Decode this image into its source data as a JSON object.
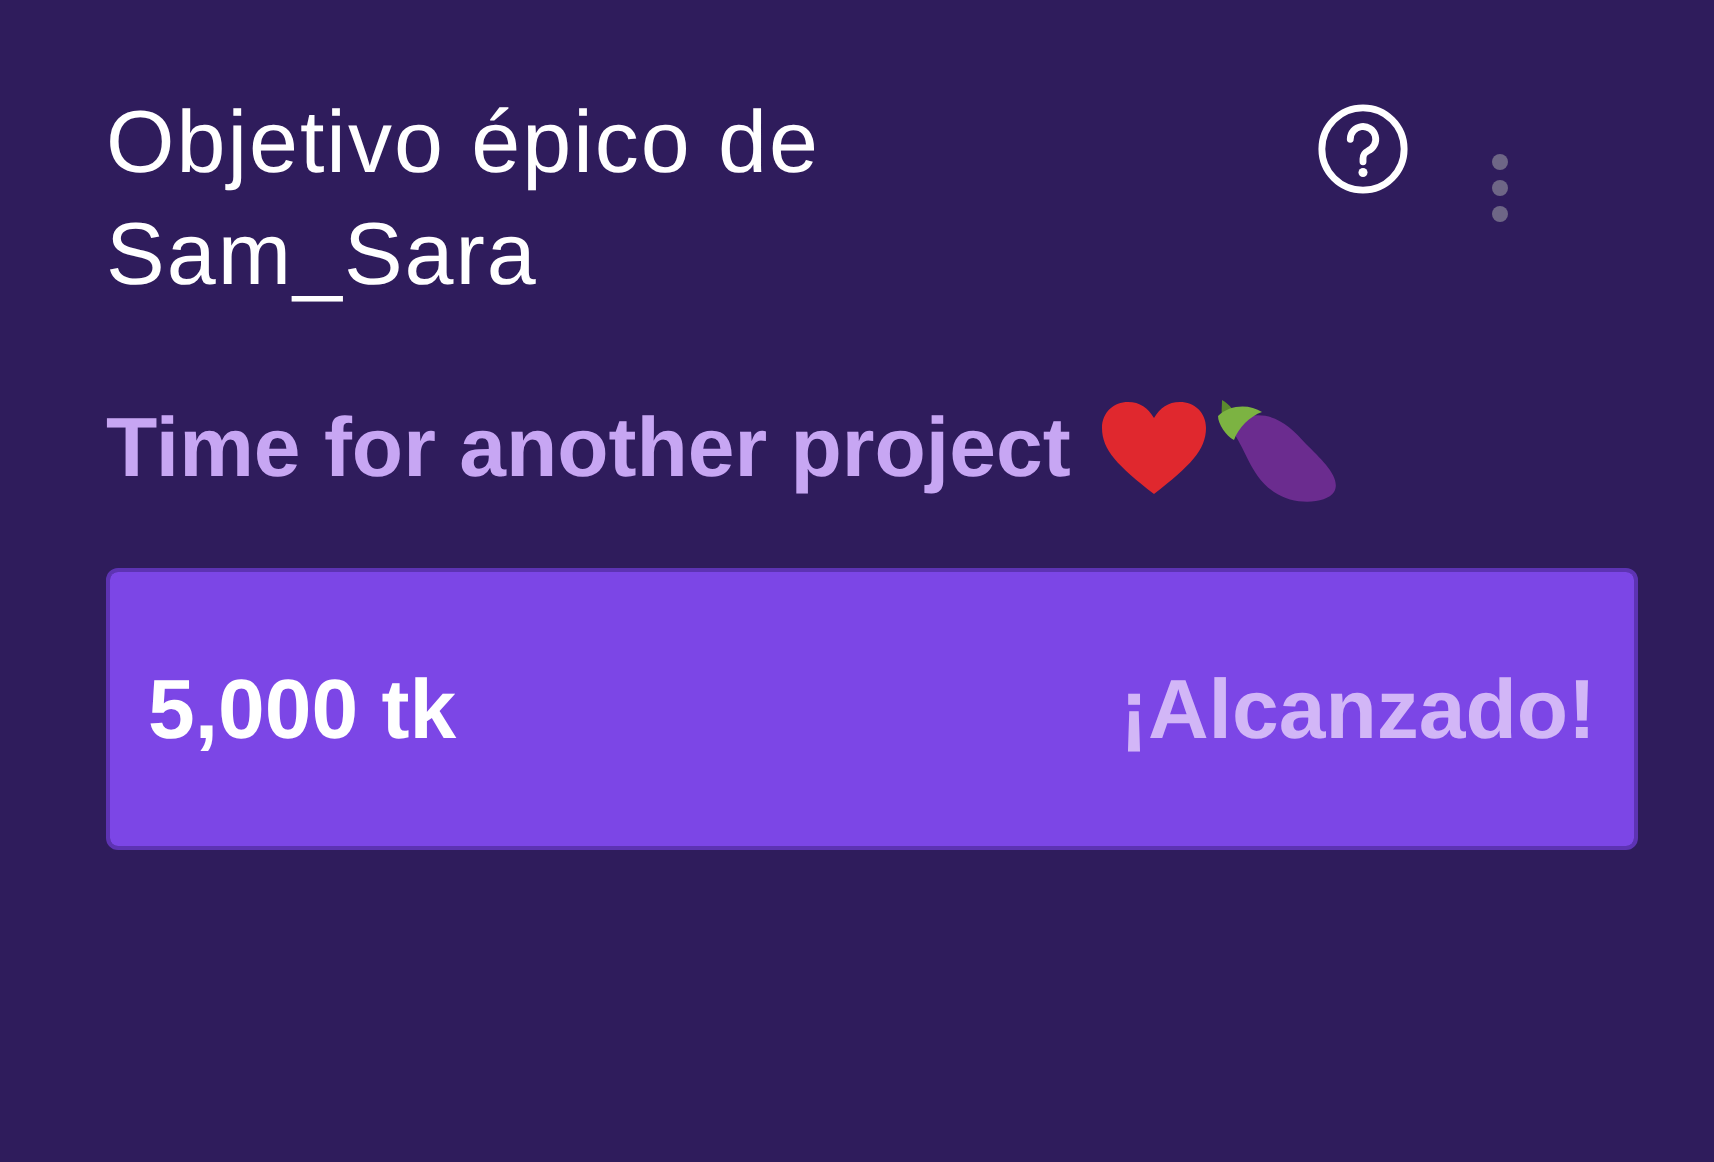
{
  "goal": {
    "title": "Objetivo épico de Sam_Sara",
    "description": "Time for another project",
    "progress": {
      "amount": "5,000 tk",
      "status": "¡Alcanzado!",
      "level": 1
    }
  }
}
